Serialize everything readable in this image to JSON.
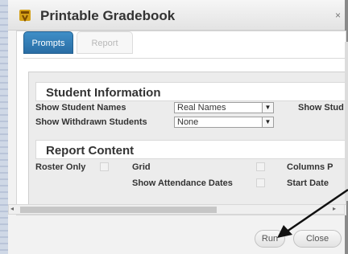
{
  "window": {
    "title": "Printable Gradebook",
    "icon": "gradebook-icon",
    "close_glyph": "×"
  },
  "tabs": [
    {
      "label": "Prompts",
      "active": true
    },
    {
      "label": "Report",
      "active": false
    }
  ],
  "sections": {
    "student_information": {
      "title": "Student Information",
      "show_student_names": {
        "label": "Show Student Names",
        "value": "Real Names"
      },
      "show_withdrawn_students": {
        "label": "Show Withdrawn Students",
        "value": "None"
      },
      "show_stud_cut": "Show Stud"
    },
    "report_content": {
      "title": "Report Content",
      "roster_only": {
        "label": "Roster Only"
      },
      "grid": {
        "label": "Grid"
      },
      "show_attendance_dates": {
        "label": "Show Attendance Dates"
      },
      "columns_cut": "Columns P",
      "start_date": "Start Date"
    }
  },
  "buttons": {
    "run": "Run",
    "close": "Close"
  },
  "colors": {
    "tab_active": "#2a6ea5",
    "annotation_arrow": "#111111"
  }
}
